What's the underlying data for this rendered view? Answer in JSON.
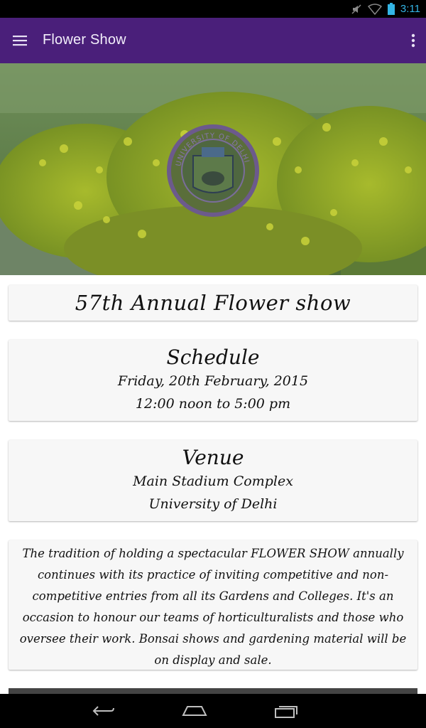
{
  "status_bar": {
    "time": "3:11"
  },
  "app_bar": {
    "title": "Flower Show"
  },
  "hero": {
    "seal_text": "UNIVERSITY OF DELHI"
  },
  "cards": {
    "title": "57th Annual Flower show",
    "schedule": {
      "heading": "Schedule",
      "date": "Friday, 20th February, 2015",
      "time": "12:00 noon to 5:00 pm"
    },
    "venue": {
      "heading": "Venue",
      "line1": "Main Stadium Complex",
      "line2": "University of Delhi"
    },
    "description": "The tradition of holding a spectacular FLOWER SHOW annually continues with its practice of inviting competitive and non-competitive entries from all its Gardens and Colleges. It's an occasion to honour our teams of  horticulturalists and those who oversee their work. Bonsai shows and gardening material will be on display and sale."
  },
  "colors": {
    "app_bar": "#4a1f7a",
    "status_time": "#33b5e5",
    "card_bg": "#f7f7f7"
  },
  "icons": {
    "menu": "hamburger-icon",
    "overflow": "overflow-dots-icon",
    "back": "back-icon",
    "home": "home-icon",
    "recent": "recent-apps-icon"
  }
}
